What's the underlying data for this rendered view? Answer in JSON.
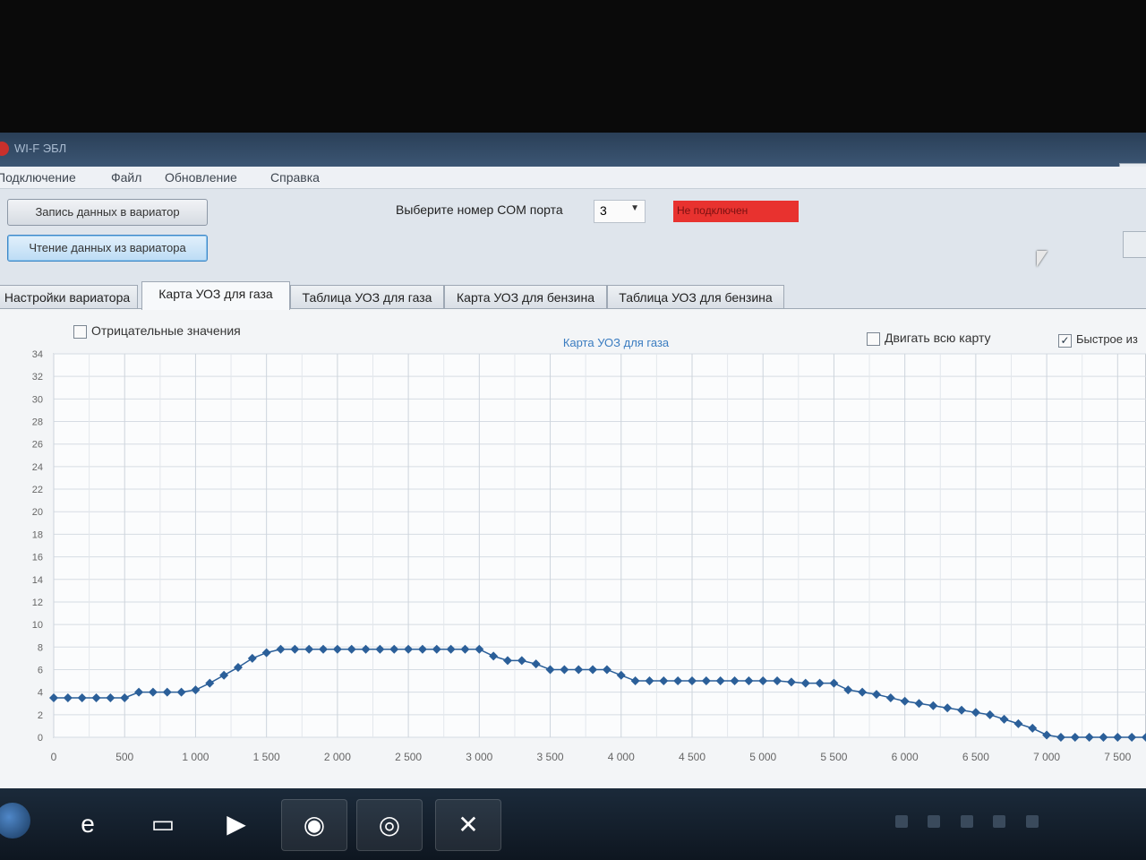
{
  "window": {
    "title": "WI-F ЭБЛ"
  },
  "menu": [
    "Подключение",
    "Файл",
    "Обновление",
    "Справка"
  ],
  "toolbar": {
    "write_button": "Запись данных в вариатор",
    "read_button": "Чтение данных из вариатора",
    "com_label": "Выберите номер COM порта",
    "com_value": "3",
    "status_text": "Не подключен"
  },
  "tabs": [
    "Настройки вариатора",
    "Карта УОЗ для газа",
    "Таблица УОЗ для газа",
    "Карта УОЗ для бензина",
    "Таблица УОЗ для бензина"
  ],
  "panel": {
    "negative_values": "Отрицательные значения",
    "move_whole_map": "Двигать всю карту",
    "fast_mode": "Быстрое из"
  },
  "chart_data": {
    "type": "line",
    "title": "Карта УОЗ для газа",
    "xlabel": "",
    "ylabel": "",
    "xlim": [
      0,
      7700
    ],
    "ylim": [
      0,
      34
    ],
    "x_ticks": [
      "0",
      "500",
      "1 000",
      "1 500",
      "2 000",
      "2 500",
      "3 000",
      "3 500",
      "4 000",
      "4 500",
      "5 000",
      "5 500",
      "6 000",
      "6 500",
      "7 000",
      "7 500"
    ],
    "y_ticks": [
      "0",
      "2",
      "4",
      "6",
      "8",
      "10",
      "12",
      "14",
      "16",
      "18",
      "20",
      "22",
      "24",
      "26",
      "28",
      "30",
      "32",
      "34"
    ],
    "grid": true,
    "marker": "diamond",
    "color": "#2b5f99",
    "series": [
      {
        "x": [
          0,
          100,
          200,
          300,
          400,
          500,
          600,
          700,
          800,
          900,
          1000,
          1100,
          1200,
          1300,
          1400,
          1500,
          1600,
          1700,
          1800,
          1900,
          2000,
          2100,
          2200,
          2300,
          2400,
          2500,
          2600,
          2700,
          2800,
          2900,
          3000,
          3100,
          3200,
          3300,
          3400,
          3500,
          3600,
          3700,
          3800,
          3900,
          4000,
          4100,
          4200,
          4300,
          4400,
          4500,
          4600,
          4700,
          4800,
          4900,
          5000,
          5100,
          5200,
          5300,
          5400,
          5500,
          5600,
          5700,
          5800,
          5900,
          6000,
          6100,
          6200,
          6300,
          6400,
          6500,
          6600,
          6700,
          6800,
          6900,
          7000,
          7100,
          7200,
          7300,
          7400,
          7500,
          7600,
          7700
        ],
        "values": [
          3.5,
          3.5,
          3.5,
          3.5,
          3.5,
          3.5,
          4,
          4,
          4,
          4,
          4.2,
          4.8,
          5.5,
          6.2,
          7,
          7.5,
          7.8,
          7.8,
          7.8,
          7.8,
          7.8,
          7.8,
          7.8,
          7.8,
          7.8,
          7.8,
          7.8,
          7.8,
          7.8,
          7.8,
          7.8,
          7.2,
          6.8,
          6.8,
          6.5,
          6,
          6,
          6,
          6,
          6,
          5.5,
          5,
          5,
          5,
          5,
          5,
          5,
          5,
          5,
          5,
          5,
          5,
          4.9,
          4.8,
          4.8,
          4.8,
          4.2,
          4,
          3.8,
          3.5,
          3.2,
          3,
          2.8,
          2.6,
          2.4,
          2.2,
          2,
          1.6,
          1.2,
          0.8,
          0.2,
          0,
          0,
          0,
          0,
          0,
          0,
          0
        ]
      }
    ]
  }
}
